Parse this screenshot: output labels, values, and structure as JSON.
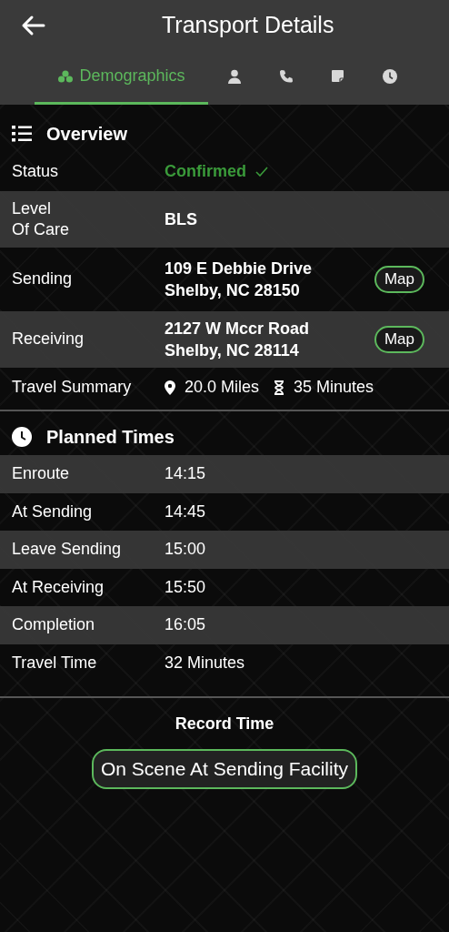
{
  "header": {
    "title": "Transport Details"
  },
  "tabs": [
    {
      "label": "Demographics",
      "selected": true
    },
    {
      "selected": false
    },
    {
      "selected": false
    },
    {
      "selected": false
    },
    {
      "selected": false
    }
  ],
  "overview": {
    "title": "Overview",
    "rows": [
      {
        "kind": "status",
        "label": "Status",
        "value": "Confirmed"
      },
      {
        "kind": "text",
        "label": "Level\nOf Care",
        "value": "BLS"
      },
      {
        "kind": "address",
        "label": "Sending",
        "lines": [
          "109 E Debbie Drive",
          "Shelby, NC 28150"
        ],
        "button": "Map"
      },
      {
        "kind": "address",
        "label": "Receiving",
        "lines": [
          "2127 W Mccr Road",
          "Shelby, NC 28114"
        ],
        "button": "Map"
      },
      {
        "kind": "summary",
        "label": "Travel Summary",
        "distance": "20.0 Miles",
        "duration": "35 Minutes"
      }
    ]
  },
  "planned_times": {
    "title": "Planned Times",
    "rows": [
      {
        "label": "Enroute",
        "value": "14:15"
      },
      {
        "label": "At Sending",
        "value": "14:45"
      },
      {
        "label": "Leave Sending",
        "value": "15:00"
      },
      {
        "label": "At Receiving",
        "value": "15:50"
      },
      {
        "label": "Completion",
        "value": "16:05"
      },
      {
        "label": "Travel Time",
        "value": "32 Minutes"
      }
    ]
  },
  "record_time": {
    "title": "Record Time",
    "button": "On Scene At Sending Facility"
  }
}
